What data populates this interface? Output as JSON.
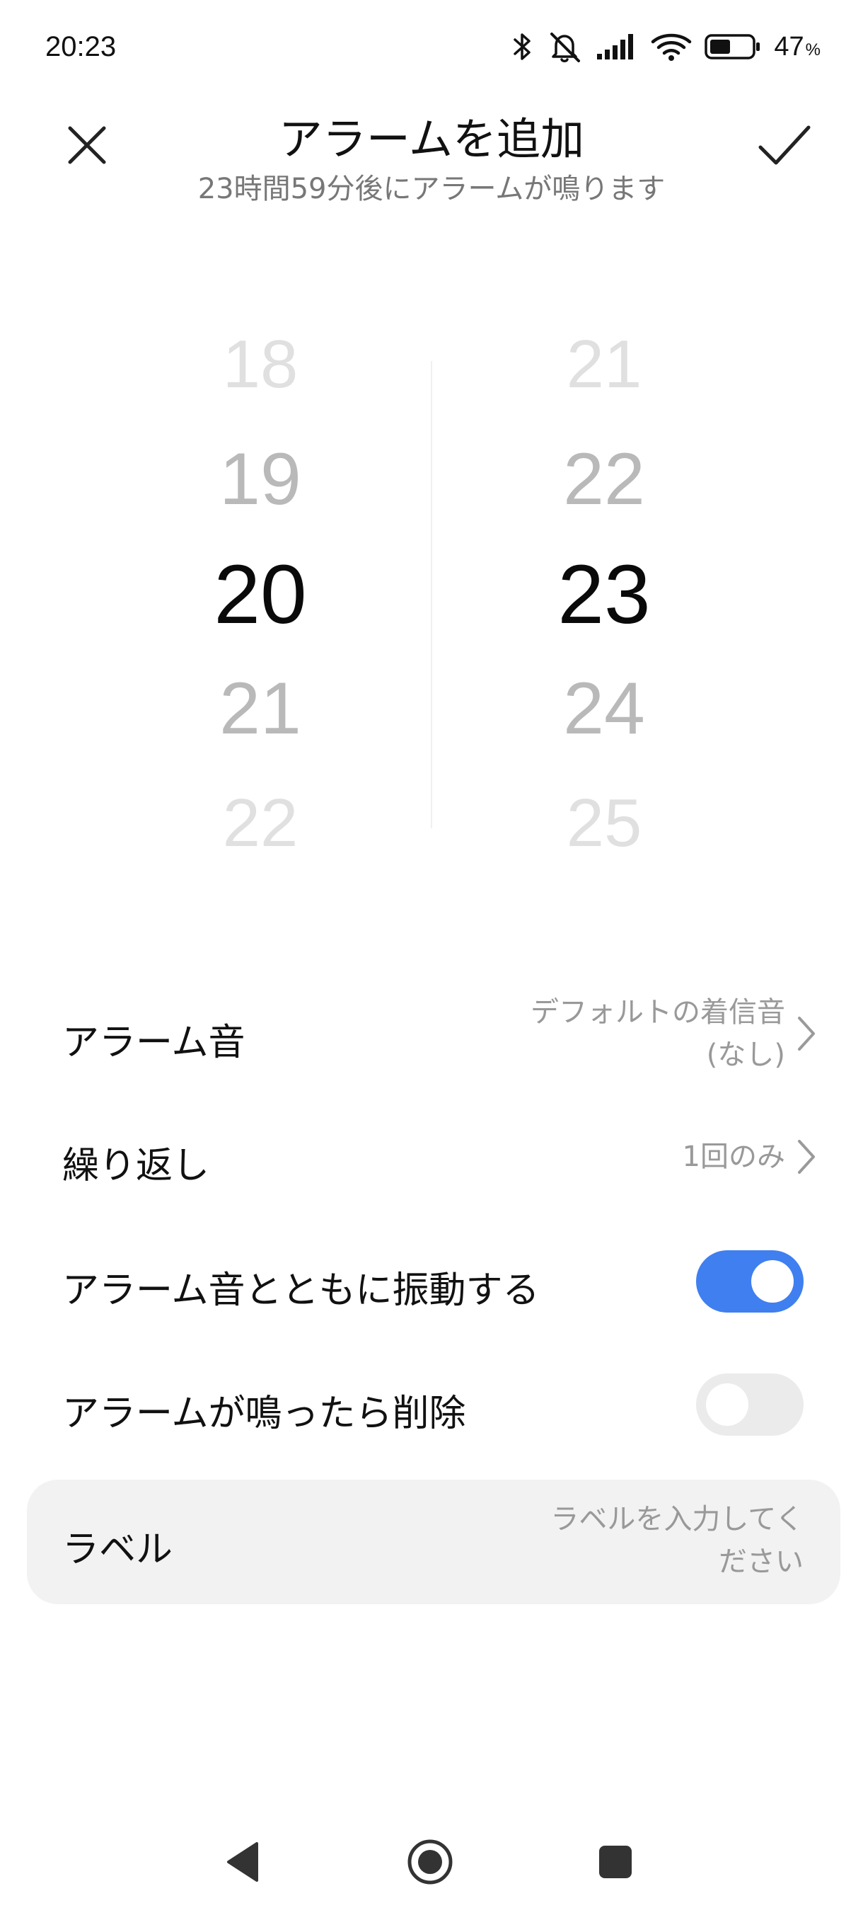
{
  "status_bar": {
    "time": "20:23",
    "battery_percent": "47",
    "battery_unit": "%",
    "icons": [
      "bluetooth-icon",
      "muted-bell-icon",
      "signal-icon",
      "wifi-icon",
      "battery-icon"
    ]
  },
  "header": {
    "title": "アラームを追加",
    "subtitle": "23時間59分後にアラームが鳴ります",
    "close_icon": "close-icon",
    "confirm_icon": "checkmark-icon"
  },
  "picker": {
    "hours": [
      "18",
      "19",
      "20",
      "21",
      "22"
    ],
    "minutes": [
      "21",
      "22",
      "23",
      "24",
      "25"
    ],
    "selected_hour": "20",
    "selected_minute": "23"
  },
  "settings": {
    "sound": {
      "label": "アラーム音",
      "value_line1": "デフォルトの着信音",
      "value_line2": "(なし)"
    },
    "repeat": {
      "label": "繰り返し",
      "value": "1回のみ"
    },
    "vibrate": {
      "label": "アラーム音とともに振動する",
      "on": true
    },
    "delete_after": {
      "label": "アラームが鳴ったら削除",
      "on": false
    },
    "alarm_label": {
      "label": "ラベル",
      "placeholder_line1": "ラベルを入力してく",
      "placeholder_line2": "ださい"
    }
  },
  "colors": {
    "accent": "#3f7ff0",
    "toggle_off": "#ebebeb",
    "card_bg": "#f2f2f2",
    "secondary_text": "#999999"
  },
  "nav_bar": {
    "icons": [
      "back-icon",
      "home-icon",
      "recents-icon"
    ]
  }
}
